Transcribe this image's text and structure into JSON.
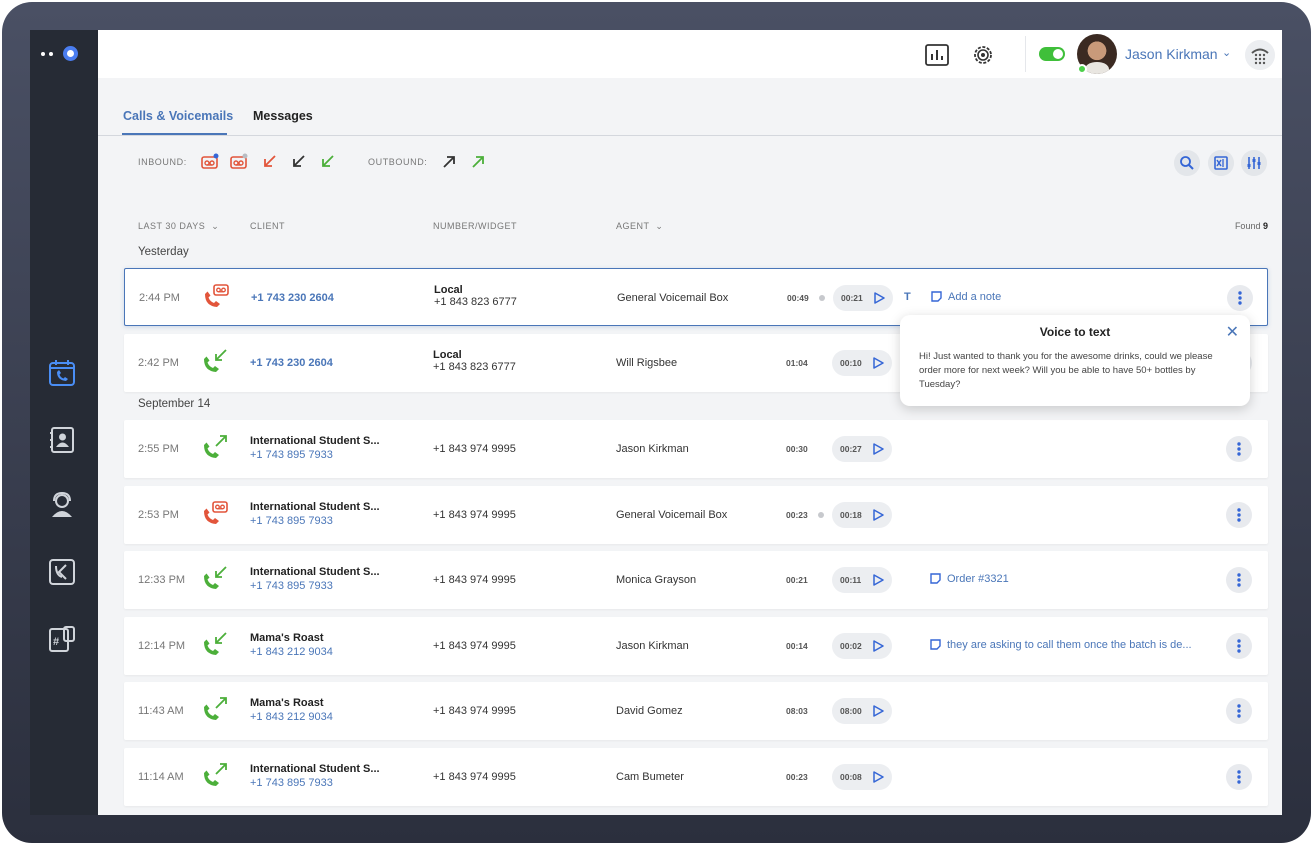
{
  "user": {
    "name": "Jason Kirkman"
  },
  "tabs": [
    {
      "label": "Calls & Voicemails",
      "active": true
    },
    {
      "label": "Messages",
      "active": false
    }
  ],
  "filters": {
    "inbound_label": "INBOUND:",
    "outbound_label": "OUTBOUND:"
  },
  "columns": {
    "date_range": "LAST 30 DAYS",
    "client": "CLIENT",
    "number_widget": "NUMBER/WIDGET",
    "agent": "AGENT"
  },
  "found": {
    "label": "Found",
    "count": "9"
  },
  "groups": [
    "Yesterday",
    "September 14"
  ],
  "colors": {
    "accent": "#4a76b8",
    "inbound_green": "#4caf3a",
    "voicemail_red": "#e2553b",
    "sidebar": "#262b35"
  },
  "rows": [
    {
      "time": "2:44 PM",
      "type": "voicemail",
      "client_name": "",
      "client_phone": "+1 743 230 2604",
      "number_line1": "Local",
      "number_line2": "+1 843 823 6777",
      "agent": "General Voicemail Box",
      "duration": "00:49",
      "played": "00:21",
      "transcript_icon": "T",
      "note": "Add a note"
    },
    {
      "time": "2:42 PM",
      "type": "inbound",
      "client_name": "",
      "client_phone": "+1 743 230 2604",
      "number_line1": "Local",
      "number_line2": "+1 843 823 6777",
      "agent": "Will Rigsbee",
      "duration": "01:04",
      "played": "00:10",
      "note": ""
    },
    {
      "time": "2:55 PM",
      "type": "outbound",
      "client_name": "International Student S...",
      "client_phone": "+1 743 895 7933",
      "number_line1": "",
      "number_line2": "+1 843 974 9995",
      "agent": "Jason Kirkman",
      "duration": "00:30",
      "played": "00:27",
      "note": ""
    },
    {
      "time": "2:53 PM",
      "type": "voicemail",
      "client_name": "International Student S...",
      "client_phone": "+1 743 895 7933",
      "number_line1": "",
      "number_line2": "+1 843 974 9995",
      "agent": "General Voicemail Box",
      "duration": "00:23",
      "played": "00:18",
      "note": ""
    },
    {
      "time": "12:33 PM",
      "type": "inbound",
      "client_name": "International Student S...",
      "client_phone": "+1 743 895 7933",
      "number_line1": "",
      "number_line2": "+1 843 974 9995",
      "agent": "Monica Grayson",
      "duration": "00:21",
      "played": "00:11",
      "note": "Order #3321"
    },
    {
      "time": "12:14 PM",
      "type": "inbound",
      "client_name": "Mama's Roast",
      "client_phone": "+1 843 212 9034",
      "number_line1": "",
      "number_line2": "+1 843 974 9995",
      "agent": "Jason Kirkman",
      "duration": "00:14",
      "played": "00:02",
      "note": "they are asking to call them once the batch is de..."
    },
    {
      "time": "11:43 AM",
      "type": "outbound",
      "client_name": "Mama's Roast",
      "client_phone": "+1 843 212 9034",
      "number_line1": "",
      "number_line2": "+1 843 974 9995",
      "agent": "David Gomez",
      "duration": "08:03",
      "played": "08:00",
      "note": ""
    },
    {
      "time": "11:14 AM",
      "type": "outbound",
      "client_name": "International Student S...",
      "client_phone": "+1 743 895 7933",
      "number_line1": "",
      "number_line2": "+1 843 974 9995",
      "agent": "Cam Bumeter",
      "duration": "00:23",
      "played": "00:08",
      "note": ""
    }
  ],
  "popup": {
    "title": "Voice to text",
    "body": "Hi! Just wanted to thank you for the awesome drinks, could we please order more for next week? Will you be able to have 50+ bottles by Tuesday?"
  }
}
